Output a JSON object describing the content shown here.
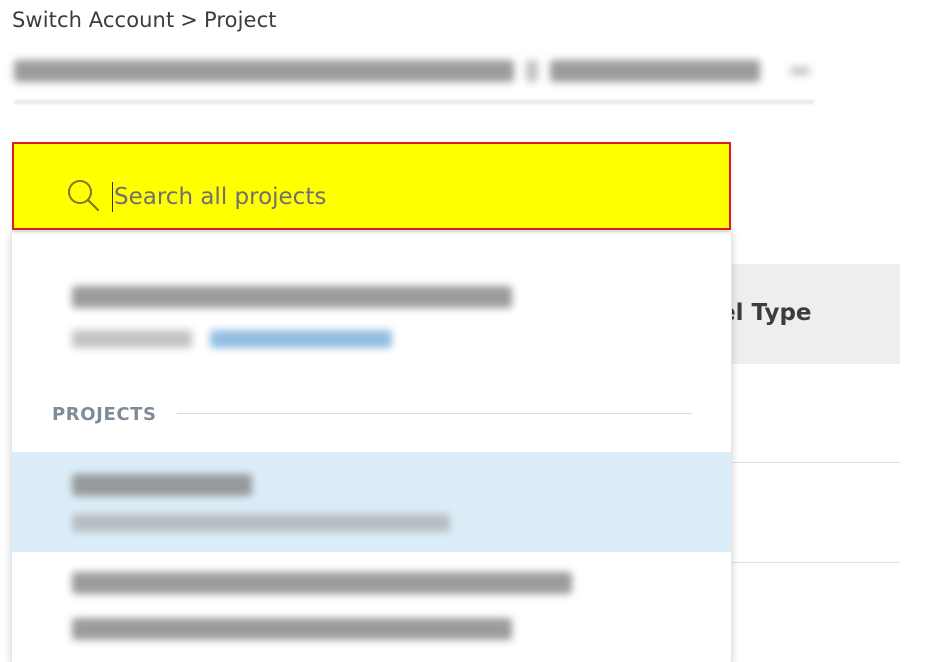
{
  "breadcrumb": {
    "root": "Switch Account",
    "separator": ">",
    "current": "Project"
  },
  "search": {
    "placeholder": "Search all projects",
    "value": "",
    "highlight_color": "#ffff00",
    "border_color": "#d42020"
  },
  "dropdown": {
    "section_label": "PROJECTS"
  },
  "table": {
    "column_header": "el Type"
  },
  "colors": {
    "selected_row": "#dbedf8",
    "section_label": "#7f8c97"
  }
}
